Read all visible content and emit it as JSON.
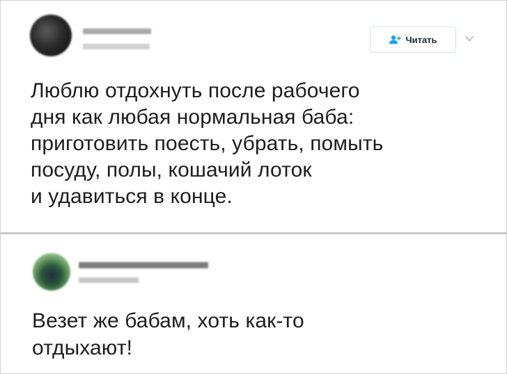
{
  "tweets": [
    {
      "follow_label": "Читать",
      "text_lines": [
        "Люблю отдохнуть после рабочего",
        "дня как любая нормальная баба:",
        "приготовить поесть, убрать, помыть",
        "посуду, полы, кошачий лоток",
        "и удавиться в конце."
      ],
      "icons": {
        "follow": "add-user-icon",
        "more": "chevron-down-icon"
      }
    },
    {
      "text_lines": [
        "Везет же бабам, хоть как-то",
        "отдыхают!"
      ]
    }
  ],
  "colors": {
    "accent": "#1da1f2",
    "text": "#1d1d1d",
    "divider": "#c8c8c8"
  }
}
